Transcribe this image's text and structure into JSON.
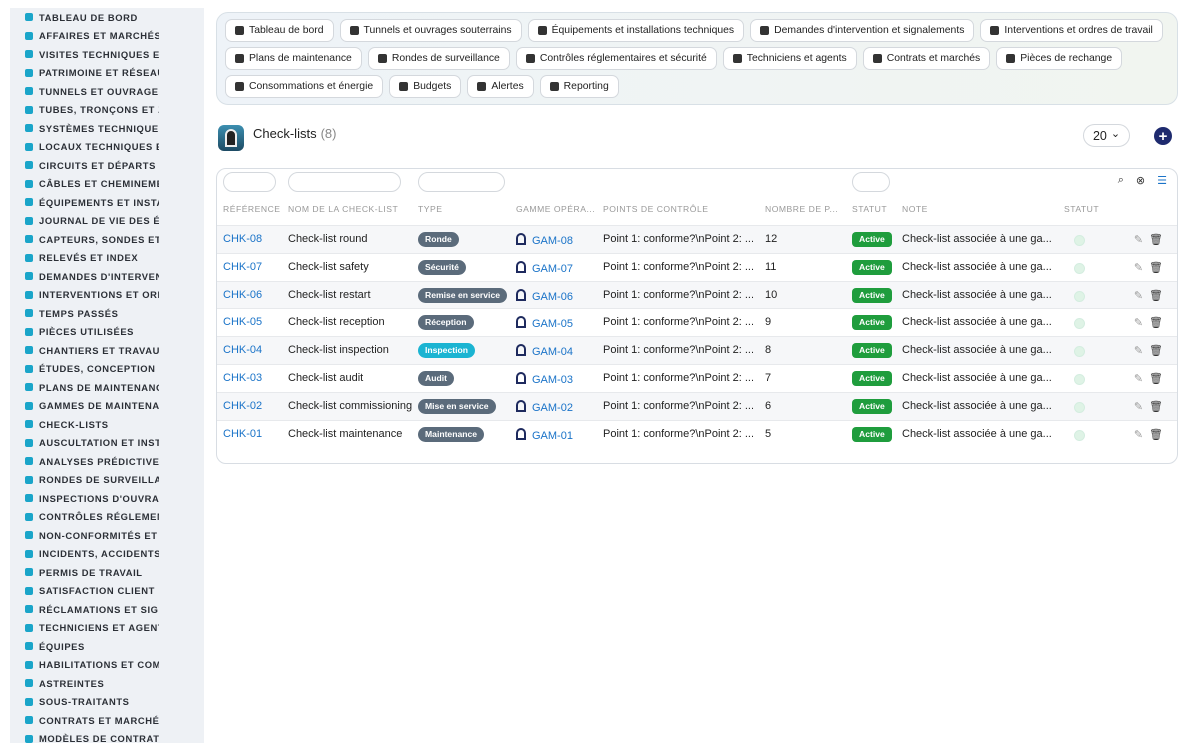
{
  "sidebar": {
    "items": [
      {
        "label": "TABLEAU DE BORD",
        "icon": "gauge-icon"
      },
      {
        "label": "AFFAIRES ET MARCHÉS",
        "icon": "target-icon"
      },
      {
        "label": "VISITES TECHNIQUES ET",
        "icon": "walk-icon"
      },
      {
        "label": "PATRIMOINE ET RÉSEAUX",
        "icon": "network-icon"
      },
      {
        "label": "TUNNELS ET OUVRAGES",
        "icon": "building-icon"
      },
      {
        "label": "TUBES, TRONÇONS ET ZO",
        "icon": "road-icon"
      },
      {
        "label": "SYSTÈMES TECHNIQUES",
        "icon": "sitemap-icon"
      },
      {
        "label": "LOCAUX TECHNIQUES ET",
        "icon": "grid-icon"
      },
      {
        "label": "CIRCUITS ET DÉPARTS É",
        "icon": "bolt-icon"
      },
      {
        "label": "CÂBLES ET CHEMINEMEN",
        "icon": "cable-icon"
      },
      {
        "label": "ÉQUIPEMENTS ET INSTAL",
        "icon": "gears-icon"
      },
      {
        "label": "JOURNAL DE VIE DES ÉQ",
        "icon": "history-icon"
      },
      {
        "label": "CAPTEURS, SONDES ET C",
        "icon": "sensor-icon"
      },
      {
        "label": "RELEVÉS ET INDEX",
        "icon": "clipboard-icon"
      },
      {
        "label": "DEMANDES D'INTERVENT",
        "icon": "question-icon"
      },
      {
        "label": "INTERVENTIONS ET ORDI",
        "icon": "clipboard-check-icon"
      },
      {
        "label": "TEMPS PASSÉS",
        "icon": "clock-icon"
      },
      {
        "label": "PIÈCES UTILISÉES",
        "icon": "tools-icon"
      },
      {
        "label": "CHANTIERS ET TRAVAUX",
        "icon": "hammer-icon"
      },
      {
        "label": "ÉTUDES, CONCEPTION ET",
        "icon": "ruler-icon"
      },
      {
        "label": "PLANS DE MAINTENANCE",
        "icon": "calendar-icon"
      },
      {
        "label": "GAMMES DE MAINTENAN",
        "icon": "list-icon"
      },
      {
        "label": "CHECK-LISTS",
        "icon": "checklist-icon"
      },
      {
        "label": "AUSCULTATION ET INSTR",
        "icon": "thermometer-icon"
      },
      {
        "label": "ANALYSES PRÉDICTIVES",
        "icon": "chart-icon"
      },
      {
        "label": "RONDES DE SURVEILLAN",
        "icon": "route-icon"
      },
      {
        "label": "INSPECTIONS D'OUVRAG",
        "icon": "search-icon"
      },
      {
        "label": "CONTRÔLES RÉGLEMENT",
        "icon": "shield-icon"
      },
      {
        "label": "NON-CONFORMITÉS ET A",
        "icon": "warning-circle-icon"
      },
      {
        "label": "INCIDENTS, ACCIDENTS E",
        "icon": "warning-triangle-icon"
      },
      {
        "label": "PERMIS DE TRAVAIL",
        "icon": "permit-icon"
      },
      {
        "label": "SATISFACTION CLIENT",
        "icon": "smile-icon"
      },
      {
        "label": "RÉCLAMATIONS ET SIGN.",
        "icon": "comment-icon"
      },
      {
        "label": "TECHNICIENS ET AGENTS",
        "icon": "hardhat-icon"
      },
      {
        "label": "ÉQUIPES",
        "icon": "users-icon"
      },
      {
        "label": "HABILITATIONS ET COMP",
        "icon": "certificate-icon"
      },
      {
        "label": "ASTREINTES",
        "icon": "phone-icon"
      },
      {
        "label": "SOUS-TRAITANTS",
        "icon": "handshake-icon"
      },
      {
        "label": "CONTRATS ET MARCHÉS",
        "icon": "contract-icon"
      },
      {
        "label": "MODÈLES DE CONTRATS",
        "icon": "template-icon"
      }
    ]
  },
  "topnav": {
    "rows": [
      [
        {
          "label": "Tableau de bord",
          "icon": "gauge-icon"
        },
        {
          "label": "Tunnels et ouvrages souterrains",
          "icon": "building-icon"
        },
        {
          "label": "Équipements et installations techniques",
          "icon": "gears-icon"
        },
        {
          "label": "Demandes d'intervention et signalements",
          "icon": "question-icon"
        },
        {
          "label": "Interventions et ordres de travail",
          "icon": "clipboard-check-icon"
        }
      ],
      [
        {
          "label": "Plans de maintenance",
          "icon": "calendar-icon"
        },
        {
          "label": "Rondes de surveillance",
          "icon": "route-icon"
        },
        {
          "label": "Contrôles réglementaires et sécurité",
          "icon": "shield-icon"
        },
        {
          "label": "Techniciens et agents",
          "icon": "hardhat-icon"
        },
        {
          "label": "Contrats et marchés",
          "icon": "contract-icon"
        },
        {
          "label": "Pièces de rechange",
          "icon": "sitemap-icon"
        }
      ],
      [
        {
          "label": "Consommations et énergie",
          "icon": "bolt-icon"
        },
        {
          "label": "Budgets",
          "icon": "money-icon"
        },
        {
          "label": "Alertes",
          "icon": "bell-icon"
        },
        {
          "label": "Reporting",
          "icon": "pie-icon"
        }
      ]
    ]
  },
  "header": {
    "title": "Check-lists",
    "count": "(8)",
    "page_size": "20",
    "page_size_chevron": "⌄",
    "add_symbol": "+"
  },
  "table": {
    "columns": [
      "RÉFÉRENCE",
      "NOM DE LA CHECK-LIST",
      "TYPE",
      "GAMME OPÉRA...",
      "POINTS DE CONTRÔLE",
      "NOMBRE DE P...",
      "STATUT",
      "NOTE",
      "STATUT"
    ],
    "rows": [
      {
        "ref": "CHK-08",
        "name": "Check-list round",
        "type": "Ronde",
        "type_color": "#5b6b7b",
        "gamme": "GAM-08",
        "points": "Point 1: conforme?\\nPoint 2: ...",
        "count": "12",
        "status": "Active",
        "note": "Check-list associée à une ga..."
      },
      {
        "ref": "CHK-07",
        "name": "Check-list safety",
        "type": "Sécurité",
        "type_color": "#5b6b7b",
        "gamme": "GAM-07",
        "points": "Point 1: conforme?\\nPoint 2: ...",
        "count": "11",
        "status": "Active",
        "note": "Check-list associée à une ga..."
      },
      {
        "ref": "CHK-06",
        "name": "Check-list restart",
        "type": "Remise en service",
        "type_color": "#5b6b7b",
        "gamme": "GAM-06",
        "points": "Point 1: conforme?\\nPoint 2: ...",
        "count": "10",
        "status": "Active",
        "note": "Check-list associée à une ga..."
      },
      {
        "ref": "CHK-05",
        "name": "Check-list reception",
        "type": "Réception",
        "type_color": "#5b6b7b",
        "gamme": "GAM-05",
        "points": "Point 1: conforme?\\nPoint 2: ...",
        "count": "9",
        "status": "Active",
        "note": "Check-list associée à une ga..."
      },
      {
        "ref": "CHK-04",
        "name": "Check-list inspection",
        "type": "Inspection",
        "type_color": "#1bb4d2",
        "gamme": "GAM-04",
        "points": "Point 1: conforme?\\nPoint 2: ...",
        "count": "8",
        "status": "Active",
        "note": "Check-list associée à une ga..."
      },
      {
        "ref": "CHK-03",
        "name": "Check-list audit",
        "type": "Audit",
        "type_color": "#5b6b7b",
        "gamme": "GAM-03",
        "points": "Point 1: conforme?\\nPoint 2: ...",
        "count": "7",
        "status": "Active",
        "note": "Check-list associée à une ga..."
      },
      {
        "ref": "CHK-02",
        "name": "Check-list commissioning",
        "type": "Mise en service",
        "type_color": "#5b6b7b",
        "gamme": "GAM-02",
        "points": "Point 1: conforme?\\nPoint 2: ...",
        "count": "6",
        "status": "Active",
        "note": "Check-list associée à une ga..."
      },
      {
        "ref": "CHK-01",
        "name": "Check-list maintenance",
        "type": "Maintenance",
        "type_color": "#5b6b7b",
        "gamme": "GAM-01",
        "points": "Point 1: conforme?\\nPoint 2: ...",
        "count": "5",
        "status": "Active",
        "note": "Check-list associée à une ga..."
      }
    ],
    "tools": {
      "search": "⌕",
      "filter_off": "⊗",
      "list": "☰"
    },
    "actions": {
      "edit": "✎",
      "delete": "🗑"
    }
  },
  "colors": {
    "accent": "#1a73c8",
    "sidebar_icon": "#1aa5c9",
    "status_active": "#1f9d3d",
    "add_button": "#1e2a6e"
  }
}
